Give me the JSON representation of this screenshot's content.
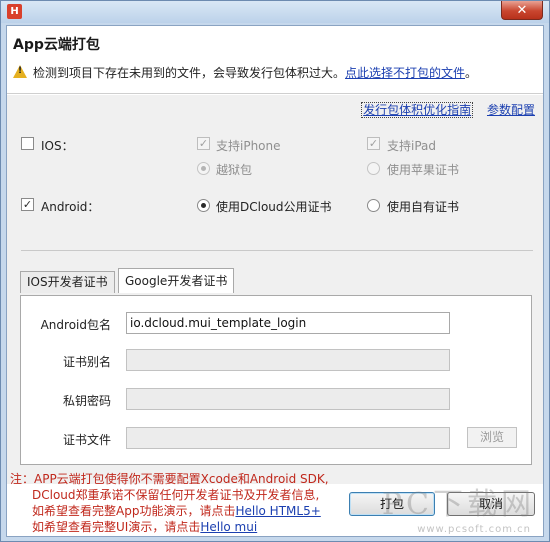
{
  "window": {
    "app_icon_glyph": "H",
    "close_glyph": "✕"
  },
  "header": {
    "title": "App云端打包",
    "warning_text": "检测到项目下存在未用到的文件，会导致发行包体积过大。",
    "warning_link": "点此选择不打包的文件",
    "warning_suffix": "。"
  },
  "links": {
    "optimize_guide": "发行包体积优化指南",
    "params_config": "参数配置"
  },
  "ios": {
    "label": "IOS：",
    "checked": false,
    "support_iphone": "支持iPhone",
    "support_ipad": "支持iPad",
    "jailbreak": "越狱包",
    "apple_cert": "使用苹果证书"
  },
  "android": {
    "label": "Android：",
    "checked": true,
    "dcloud_cert": "使用DCloud公用证书",
    "own_cert": "使用自有证书"
  },
  "tabs": [
    {
      "label": "IOS开发者证书",
      "active": false
    },
    {
      "label": "Google开发者证书",
      "active": true
    }
  ],
  "form": {
    "package_label": "Android包名",
    "package_value": "io.dcloud.mui_template_login",
    "alias_label": "证书别名",
    "alias_value": "",
    "key_password_label": "私钥密码",
    "key_password_value": "",
    "cert_file_label": "证书文件",
    "cert_file_value": "",
    "browse_label": "浏览"
  },
  "note": {
    "line1": "注：APP云端打包使得你不需要配置Xcode和Android SDK,",
    "line2": "DCloud郑重承诺不保留任何开发者证书及开发者信息,",
    "line3_prefix": "如希望查看完整App功能演示，请点击",
    "line3_link": "Hello HTML5+",
    "line4_prefix": "如希望查看完整UI演示，请点击",
    "line4_link": "Hello mui"
  },
  "buttons": {
    "pack": "打包",
    "cancel": "取消"
  },
  "watermark": {
    "text": "PC下载网",
    "url": "www.pcsoft.com.cn"
  },
  "colors": {
    "link": "#1b3fb0",
    "note_red": "#c0281c",
    "warning_yellow": "#e5b021",
    "close_red": "#c9462f"
  }
}
